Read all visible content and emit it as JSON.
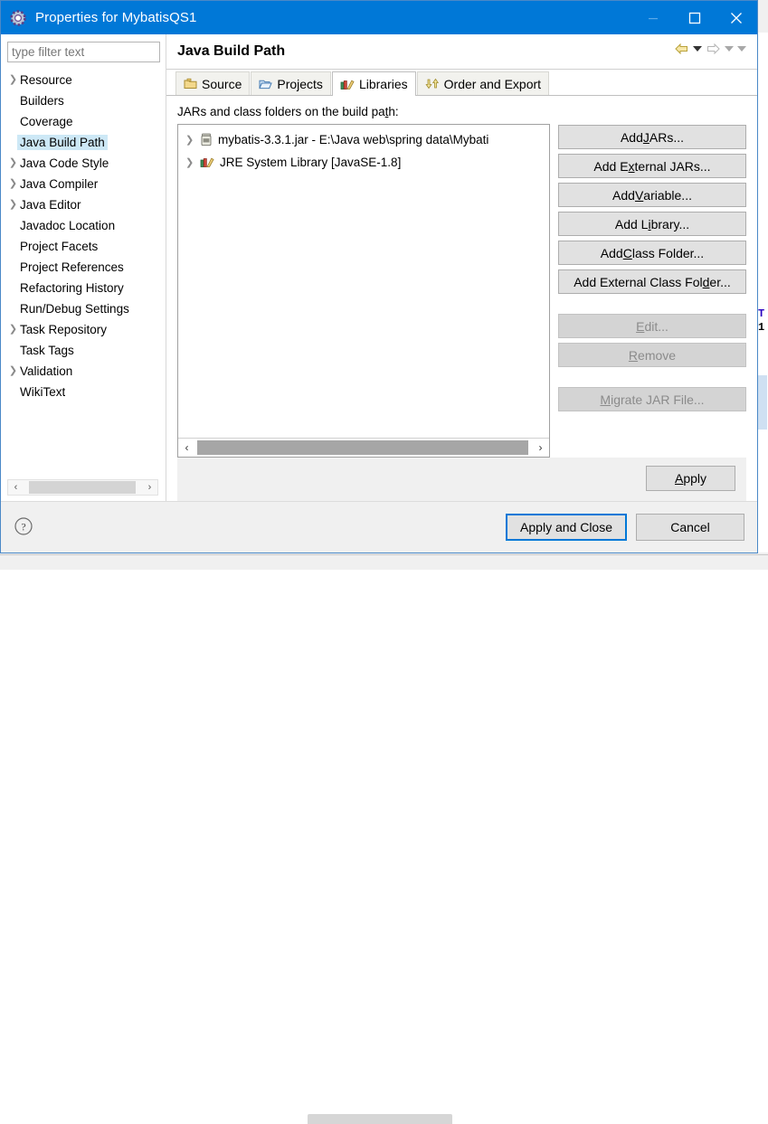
{
  "window": {
    "title": "Properties for MybatisQS1",
    "icon": "gear-icon",
    "minimize_label": "─",
    "maximize_label": "☐",
    "close_label": "✕",
    "accent_color": "#0078d7"
  },
  "sidebar": {
    "filter": {
      "value": "",
      "placeholder": "type filter text"
    },
    "items": [
      {
        "label": "Resource",
        "expandable": true,
        "selected": false
      },
      {
        "label": "Builders",
        "expandable": false,
        "selected": false
      },
      {
        "label": "Coverage",
        "expandable": false,
        "selected": false
      },
      {
        "label": "Java Build Path",
        "expandable": false,
        "selected": true
      },
      {
        "label": "Java Code Style",
        "expandable": true,
        "selected": false
      },
      {
        "label": "Java Compiler",
        "expandable": true,
        "selected": false
      },
      {
        "label": "Java Editor",
        "expandable": true,
        "selected": false
      },
      {
        "label": "Javadoc Location",
        "expandable": false,
        "selected": false
      },
      {
        "label": "Project Facets",
        "expandable": false,
        "selected": false
      },
      {
        "label": "Project References",
        "expandable": false,
        "selected": false
      },
      {
        "label": "Refactoring History",
        "expandable": false,
        "selected": false
      },
      {
        "label": "Run/Debug Settings",
        "expandable": false,
        "selected": false
      },
      {
        "label": "Task Repository",
        "expandable": true,
        "selected": false
      },
      {
        "label": "Task Tags",
        "expandable": false,
        "selected": false
      },
      {
        "label": "Validation",
        "expandable": true,
        "selected": false
      },
      {
        "label": "WikiText",
        "expandable": false,
        "selected": false
      }
    ],
    "selection_color": "#cde8f6",
    "scrollbar": {
      "left_arrow": "‹",
      "right_arrow": "›"
    }
  },
  "page": {
    "title": "Java Build Path",
    "nav": {
      "back_icon": "back-arrow-icon",
      "back_menu_icon": "chevron-down-icon",
      "forward_icon": "forward-arrow-icon",
      "forward_menu_icon": "chevron-down-icon",
      "menu_icon": "chevron-down-icon"
    },
    "tabs": [
      {
        "label": "Source",
        "icon": "source-folder-icon",
        "active": false
      },
      {
        "label": "Projects",
        "icon": "projects-folder-icon",
        "active": false
      },
      {
        "label": "Libraries",
        "icon": "libraries-icon",
        "active": true
      },
      {
        "label": "Order and Export",
        "icon": "order-export-icon",
        "active": false
      }
    ],
    "libraries": {
      "list_label": "JARs and class folders on the build path:",
      "list_label_mnemonic": "t",
      "entries": [
        {
          "label": "mybatis-3.3.1.jar - E:\\Java web\\spring data\\Mybati",
          "icon": "jar-icon",
          "expandable": true
        },
        {
          "label": "JRE System Library [JavaSE-1.8]",
          "icon": "library-icon",
          "expandable": true
        }
      ],
      "scrollbar": {
        "left_arrow": "‹",
        "right_arrow": "›"
      },
      "buttons": [
        {
          "label": "Add JARs...",
          "pre": "Add ",
          "mn": "J",
          "post": "ARs...",
          "enabled": true
        },
        {
          "label": "Add External JARs...",
          "pre": "Add E",
          "mn": "x",
          "post": "ternal JARs...",
          "enabled": true
        },
        {
          "label": "Add Variable...",
          "pre": "Add ",
          "mn": "V",
          "post": "ariable...",
          "enabled": true
        },
        {
          "label": "Add Library...",
          "pre": "Add L",
          "mn": "i",
          "post": "brary...",
          "enabled": true
        },
        {
          "label": "Add Class Folder...",
          "pre": "Add ",
          "mn": "C",
          "post": "lass Folder...",
          "enabled": true
        },
        {
          "label": "Add External Class Folder...",
          "pre": "Add External Class Fol",
          "mn": "d",
          "post": "er...",
          "enabled": true
        },
        {
          "label": "Edit...",
          "pre": "",
          "mn": "E",
          "post": "dit...",
          "enabled": false
        },
        {
          "label": "Remove",
          "pre": "",
          "mn": "R",
          "post": "emove",
          "enabled": false
        },
        {
          "label": "Migrate JAR File...",
          "pre": "",
          "mn": "M",
          "post": "igrate JAR File...",
          "enabled": false
        }
      ]
    },
    "apply_button": {
      "pre": "",
      "mn": "A",
      "post": "pply",
      "label": "Apply"
    }
  },
  "footer": {
    "help_icon": "help-icon",
    "apply_and_close": "Apply and Close",
    "cancel": "Cancel",
    "default_button_color": "#0078d7"
  },
  "background": {
    "code_line_1": "T",
    "code_line_2": "1"
  }
}
